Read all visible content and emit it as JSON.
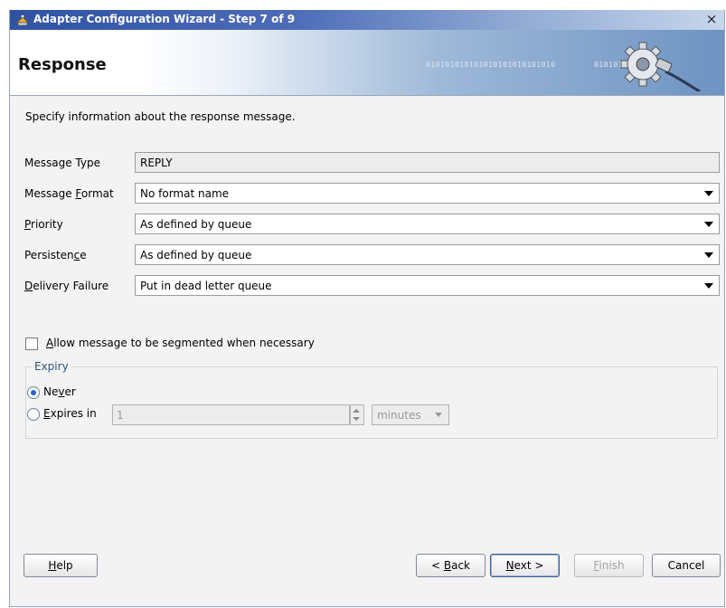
{
  "window": {
    "title": "Adapter Configuration Wizard - Step 7 of 9",
    "close_glyph": "×",
    "icon": "adapter-wizard-icon"
  },
  "banner": {
    "title": "Response",
    "binary_text": "010101010101010101010101010        0101010110",
    "graphic": "gear-plug-icon"
  },
  "form": {
    "instruction": "Specify information about the response message.",
    "message_type": {
      "label": "Message Type",
      "value": "REPLY"
    },
    "message_format": {
      "label_pre": "Message ",
      "label_mnemonic": "F",
      "label_post": "ormat",
      "value": "No format name"
    },
    "priority": {
      "label_pre": "",
      "label_mnemonic": "P",
      "label_post": "riority",
      "value": "As defined by queue"
    },
    "persistence": {
      "label_pre": "Persisten",
      "label_mnemonic": "c",
      "label_post": "e",
      "value": "As defined by queue"
    },
    "delivery_failure": {
      "label_pre": "",
      "label_mnemonic": "D",
      "label_post": "elivery Failure",
      "value": "Put in dead letter queue"
    },
    "segment_checkbox": {
      "label_pre": "",
      "label_mnemonic": "A",
      "label_post": "llow message to be segmented when necessary",
      "checked": false
    }
  },
  "expiry": {
    "title": "Expiry",
    "never": {
      "label_pre": "Ne",
      "label_mnemonic": "v",
      "label_post": "er",
      "selected": true
    },
    "expires_in": {
      "label_pre": "",
      "label_mnemonic": "E",
      "label_post": "xpires in",
      "selected": false
    },
    "amount": "1",
    "unit": "minutes"
  },
  "buttons": {
    "help": {
      "pre": "",
      "mn": "H",
      "post": "elp"
    },
    "back": {
      "pre": "< ",
      "mn": "B",
      "post": "ack"
    },
    "next": {
      "pre": "",
      "mn": "N",
      "post": "ext >"
    },
    "finish": {
      "pre": "",
      "mn": "F",
      "post": "inish"
    },
    "cancel": {
      "pre": "Cancel",
      "mn": "",
      "post": ""
    }
  },
  "colors": {
    "accent": "#2f52a4",
    "group_title": "#30527e"
  }
}
